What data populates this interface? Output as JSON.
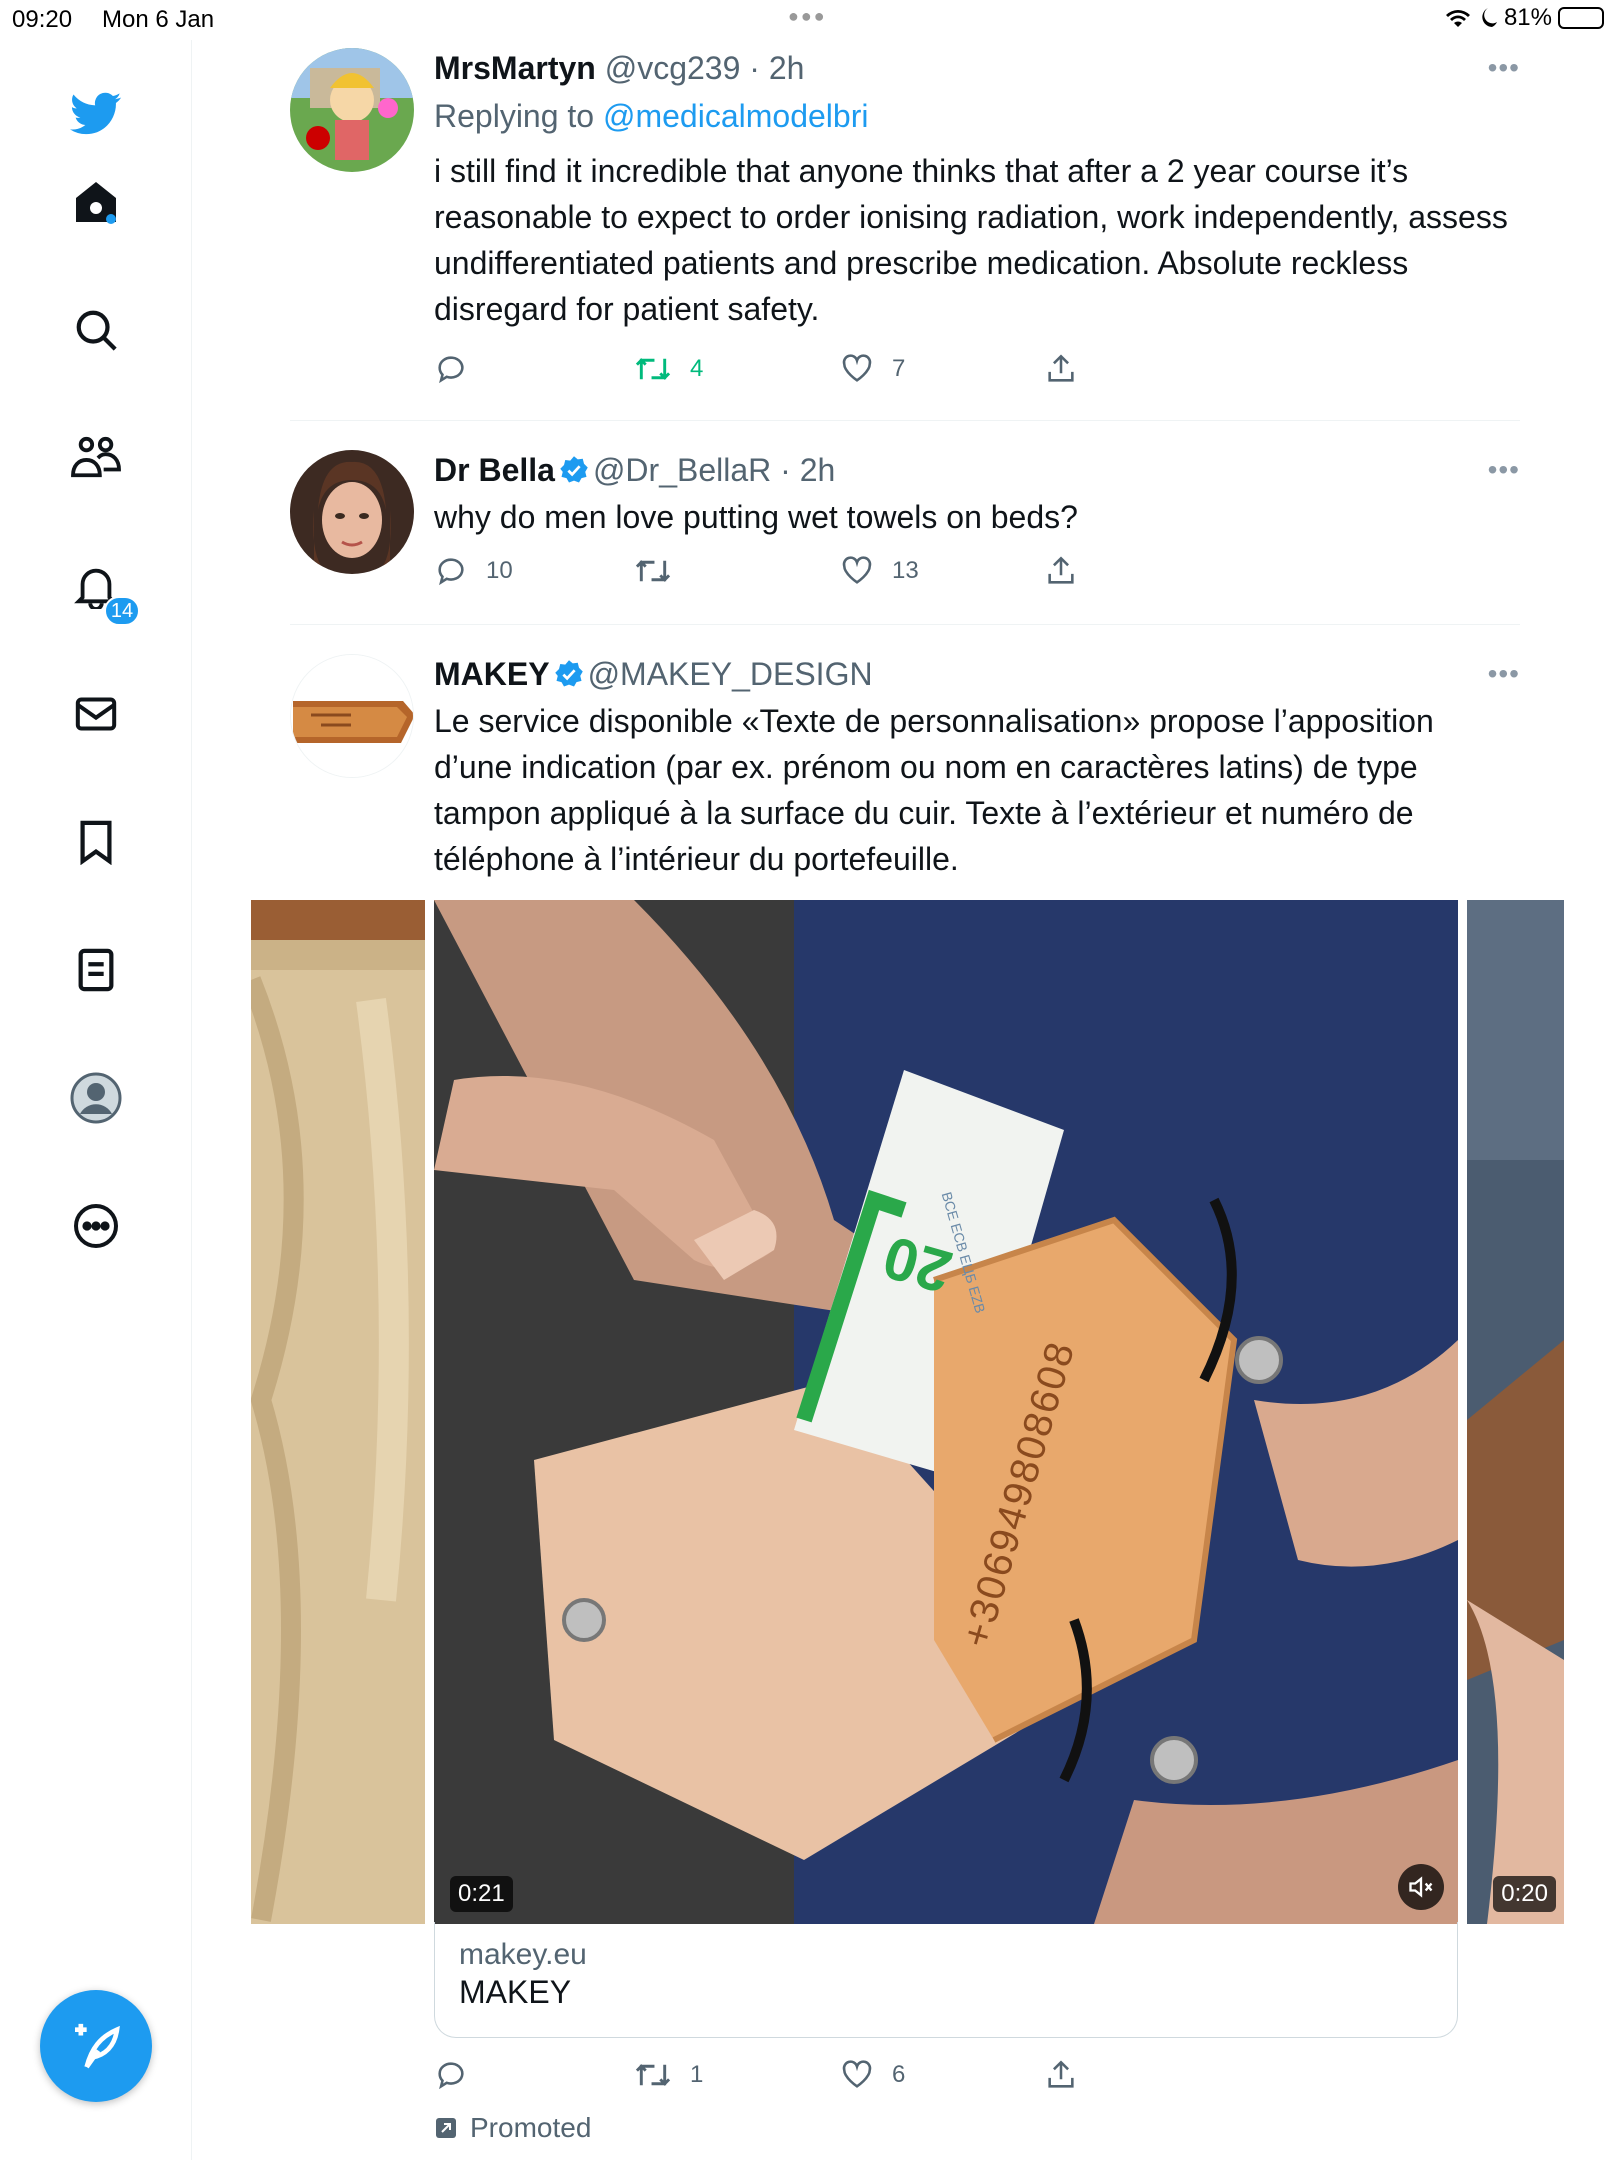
{
  "status_bar": {
    "time": "09:20",
    "date": "Mon 6 Jan",
    "battery": "81%",
    "battery_level": 0.81
  },
  "sidebar": {
    "items": [
      {
        "icon": "home-icon"
      },
      {
        "icon": "search-icon"
      },
      {
        "icon": "communities-icon"
      },
      {
        "icon": "notifications-icon",
        "badge": "14"
      },
      {
        "icon": "messages-icon"
      },
      {
        "icon": "bookmarks-icon"
      },
      {
        "icon": "lists-icon"
      },
      {
        "icon": "profile-icon"
      },
      {
        "icon": "more-icon"
      }
    ],
    "fab_icon": "compose-tweet-icon"
  },
  "tweets": [
    {
      "name": "MrsMartyn",
      "handle": "@vcg239",
      "time": "· 2h",
      "replying_prefix": "Replying to",
      "replying_to": "@medicalmodelbri",
      "text": "i still find it incredible that anyone thinks that after a 2 year course it’s reasonable to expect to order ionising radiation, work independently, assess undifferentiated patients and prescribe medication. Absolute reckless disregard for patient safety.",
      "replies": "",
      "retweets": "4",
      "likes": "7",
      "retweet_color": "#00ba7c"
    },
    {
      "name": "Dr Bella",
      "verified": true,
      "handle": "@Dr_BellaR",
      "time": "· 2h",
      "text": "why do men love putting wet towels on beds?",
      "replies": "10",
      "retweets": "",
      "likes": "13"
    },
    {
      "name": "MAKEY",
      "verified": true,
      "handle": "@MAKEY_DESIGN",
      "text": "Le service disponible «Texte de personnalisation» propose l’apposition d’une indication (par ex. prénom ou nom en caractères latins) de type tampon appliqué à la surface du cuir. Texte à l’extérieur et numéro de téléphone à l’intérieur du portefeuille.",
      "media": {
        "main_duration": "0:21",
        "next_duration": "0:20",
        "wallet_number": "+306949808608",
        "banknote_text": "20",
        "banknote_micro": "BCE ECB EЦБ EZB"
      },
      "card": {
        "domain": "makey.eu",
        "title": "MAKEY"
      },
      "replies": "",
      "retweets": "1",
      "likes": "6",
      "promoted": "Promoted"
    }
  ],
  "colors": {
    "accent": "#1d9bf0",
    "text": "#0f1419",
    "muted": "#536471",
    "retweet_active": "#00ba7c"
  }
}
